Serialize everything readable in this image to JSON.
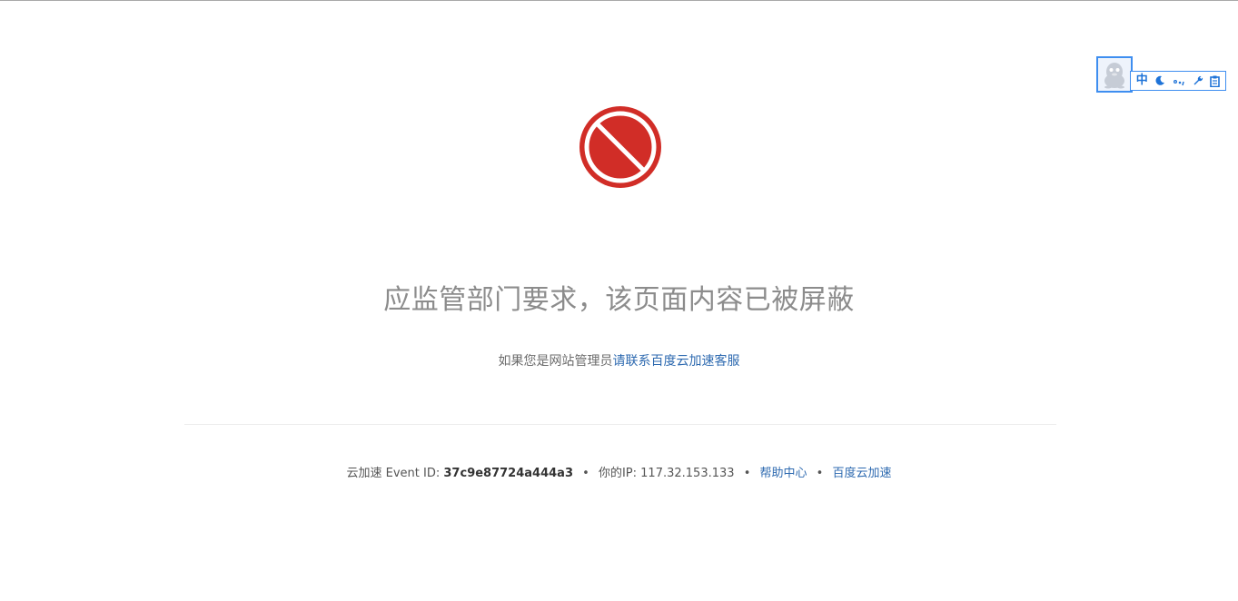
{
  "blocked_page": {
    "headline": "应监管部门要求，该页面内容已被屏蔽",
    "contact_prefix": "如果您是网站管理员",
    "contact_link": "请联系百度云加速客服",
    "icon": "blocked-icon",
    "accent_color": "#d12d27"
  },
  "footer": {
    "event_label": "云加速 Event ID: ",
    "event_id": "37c9e87724a444a3",
    "separator": "•",
    "ip_label": "你的IP: ",
    "ip_value": "117.32.153.133",
    "help_link": "帮助中心",
    "brand_link": "百度云加速"
  },
  "ime_toolbar": {
    "avatar_icon": "qq-penguin-icon",
    "mode_label": "中",
    "icons": [
      "moon-icon",
      "punctuation-icon",
      "wrench-icon",
      "clipboard-icon"
    ],
    "accent_color": "#1e73d8"
  }
}
